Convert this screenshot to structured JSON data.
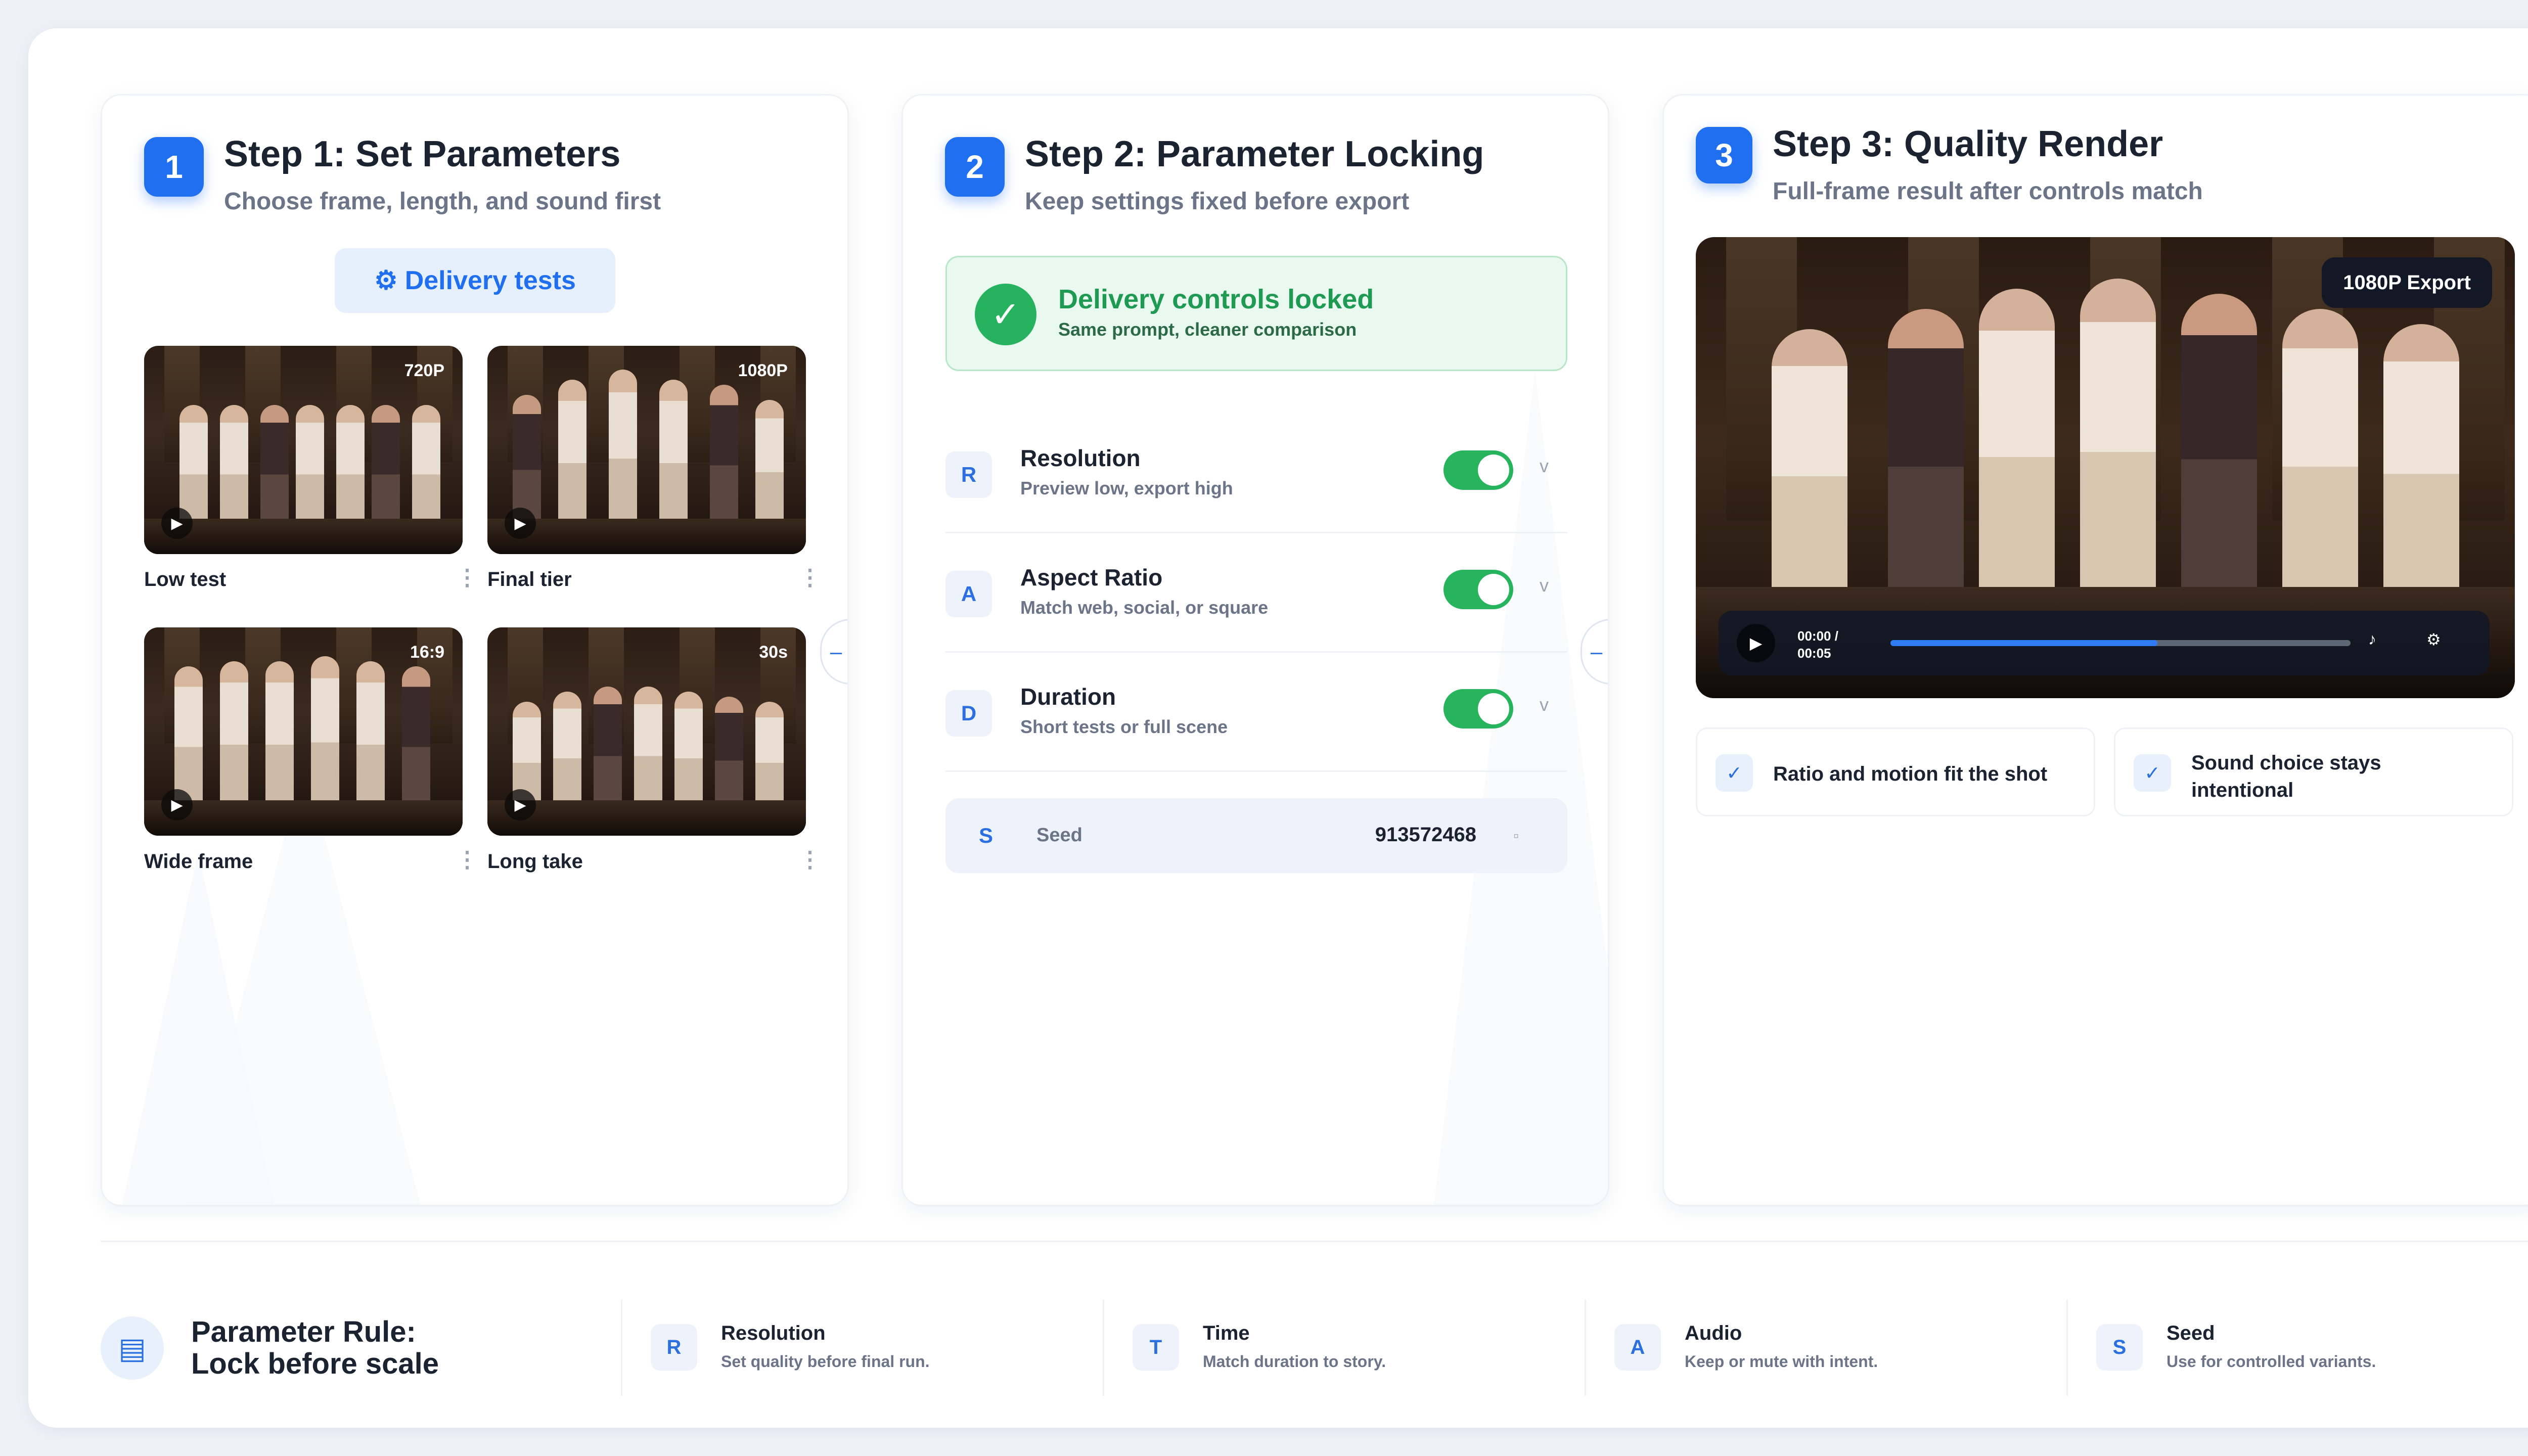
{
  "step1": {
    "number": "1",
    "title": "Step 1: Set Parameters",
    "subtitle": "Choose frame, length, and sound first",
    "pill_label": "Delivery tests",
    "thumbs": [
      {
        "tag": "720P",
        "label": "Low test"
      },
      {
        "tag": "1080P",
        "label": "Final tier"
      },
      {
        "tag": "16:9",
        "label": "Wide frame"
      },
      {
        "tag": "30s",
        "label": "Long take"
      }
    ]
  },
  "step2": {
    "number": "2",
    "title": "Step 2: Parameter Locking",
    "subtitle": "Keep settings fixed before export",
    "locked": {
      "title": "Delivery controls locked",
      "subtitle": "Same prompt, cleaner comparison"
    },
    "rows": [
      {
        "chip": "R",
        "title": "Resolution",
        "subtitle": "Preview low, export high",
        "enabled": true
      },
      {
        "chip": "A",
        "title": "Aspect Ratio",
        "subtitle": "Match web, social, or square",
        "enabled": true
      },
      {
        "chip": "D",
        "title": "Duration",
        "subtitle": "Short tests or full scene",
        "enabled": true
      }
    ],
    "seed": {
      "chip": "S",
      "label": "Seed",
      "value": "913572468"
    }
  },
  "step3": {
    "number": "3",
    "title": "Step 3: Quality Render",
    "subtitle": "Full-frame result after controls match",
    "video": {
      "badge": "1080P Export",
      "time": "00:00 / 00:05",
      "progress": 0.58
    },
    "features": [
      "Ratio and motion fit the shot",
      "Sound choice stays intentional"
    ]
  },
  "footer": {
    "rule_title_line1": "Parameter Rule:",
    "rule_title_line2": "Lock before scale",
    "items": [
      {
        "chip": "R",
        "title": "Resolution",
        "subtitle": "Set quality before final run."
      },
      {
        "chip": "T",
        "title": "Time",
        "subtitle": "Match duration to story."
      },
      {
        "chip": "A",
        "title": "Audio",
        "subtitle": "Keep or mute with intent."
      },
      {
        "chip": "S",
        "title": "Seed",
        "subtitle": "Use for controlled variants."
      }
    ]
  },
  "colors": {
    "accent": "#1f6ff0",
    "success": "#27b45d",
    "muted": "#6b7587"
  },
  "icons": {
    "pill": "gear-icon",
    "play": "play-icon",
    "check": "check-icon",
    "rule": "list-icon",
    "music": "music-icon"
  }
}
